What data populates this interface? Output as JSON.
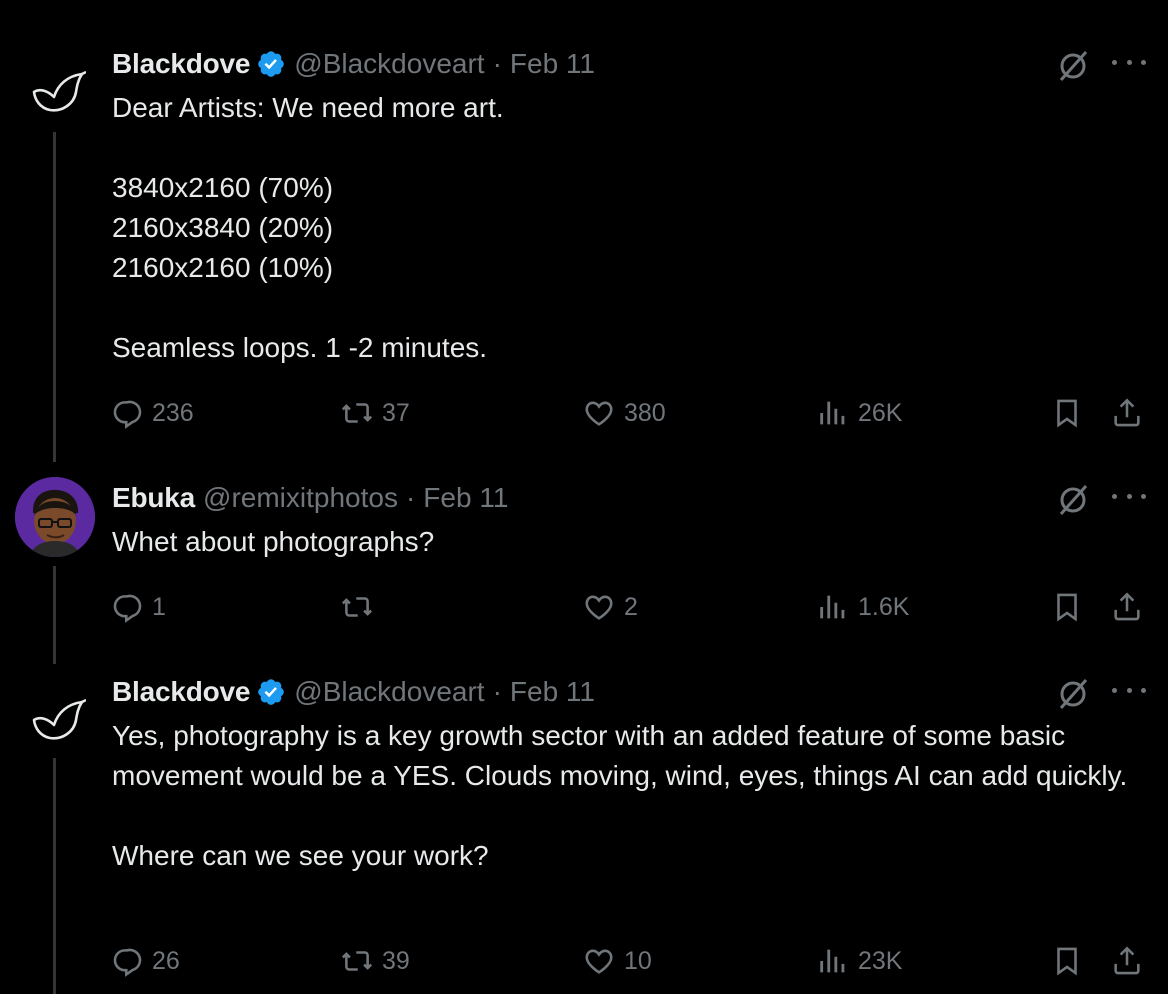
{
  "tweets": [
    {
      "name": "Blackdove",
      "handle": "@Blackdoveart",
      "separator": "·",
      "date": "Feb 11",
      "text": "Dear Artists: We need more art.\n\n3840x2160 (70%)\n2160x3840 (20%)\n2160x2160 (10%)\n\nSeamless loops.  1 -2 minutes.",
      "replies": "236",
      "reposts": "37",
      "likes": "380",
      "views": "26K"
    },
    {
      "name": "Ebuka",
      "handle": "@remixitphotos",
      "separator": "·",
      "date": "Feb 11",
      "text": "Whet about photographs?",
      "replies": "1",
      "reposts": "",
      "likes": "2",
      "views": "1.6K"
    },
    {
      "name": "Blackdove",
      "handle": "@Blackdoveart",
      "separator": "·",
      "date": "Feb 11",
      "text": "Yes, photography is a key growth sector with an added feature of some basic movement would be a YES.  Clouds moving, wind, eyes, things AI can add quickly.\n\nWhere can we see your work?",
      "replies": "26",
      "reposts": "39",
      "likes": "10",
      "views": "23K"
    }
  ],
  "colors": {
    "background": "#000000",
    "text": "#e7e9ea",
    "muted": "#71767b",
    "verified": "#1d9bf0",
    "thread_line": "#333639"
  },
  "icons": [
    "blackdove-logo-icon",
    "verified-badge-icon",
    "grok-icon",
    "more-icon",
    "reply-icon",
    "repost-icon",
    "like-icon",
    "views-icon",
    "bookmark-icon",
    "share-icon"
  ]
}
